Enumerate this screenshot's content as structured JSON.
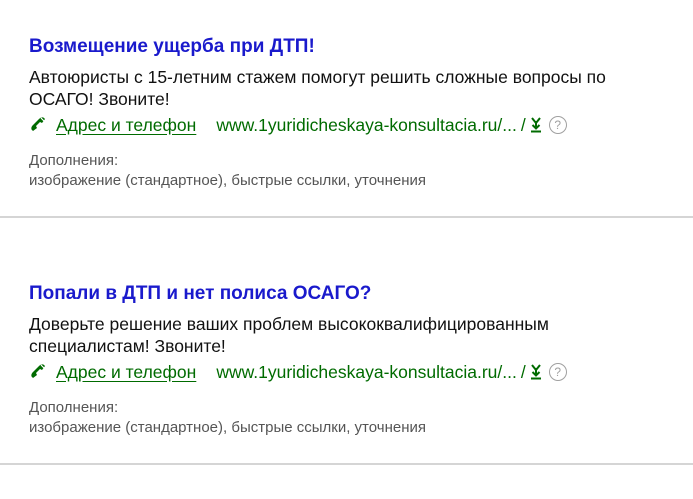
{
  "ads": [
    {
      "title": "Возмещение ущерба при ДТП!",
      "text": "Автоюристы с 15-летним стажем помогут решить сложные вопросы по ОСАГО! Звоните!",
      "contact_label": "Адрес и телефон",
      "url": "www.1yuridicheskaya-konsultacia.ru/...",
      "url_separator": "/",
      "extras_label": "Дополнения:",
      "extras_value": "изображение (стандартное), быстрые ссылки, уточнения"
    },
    {
      "title": "Попали в ДТП и нет полиса ОСАГО?",
      "text": "Доверьте решение ваших проблем высококвалифицированным специалистам! Звоните!",
      "contact_label": "Адрес и телефон",
      "url": "www.1yuridicheskaya-konsultacia.ru/...",
      "url_separator": "/",
      "extras_label": "Дополнения:",
      "extras_value": "изображение (стандартное), быстрые ссылки, уточнения"
    }
  ],
  "icons": {
    "phone": "phone-icon",
    "download": "download-icon",
    "help": "help-icon",
    "help_glyph": "?"
  },
  "colors": {
    "title": "#1a1acc",
    "green": "#006b00",
    "text": "#111111",
    "muted": "#555555",
    "divider": "#d5d5d5"
  }
}
